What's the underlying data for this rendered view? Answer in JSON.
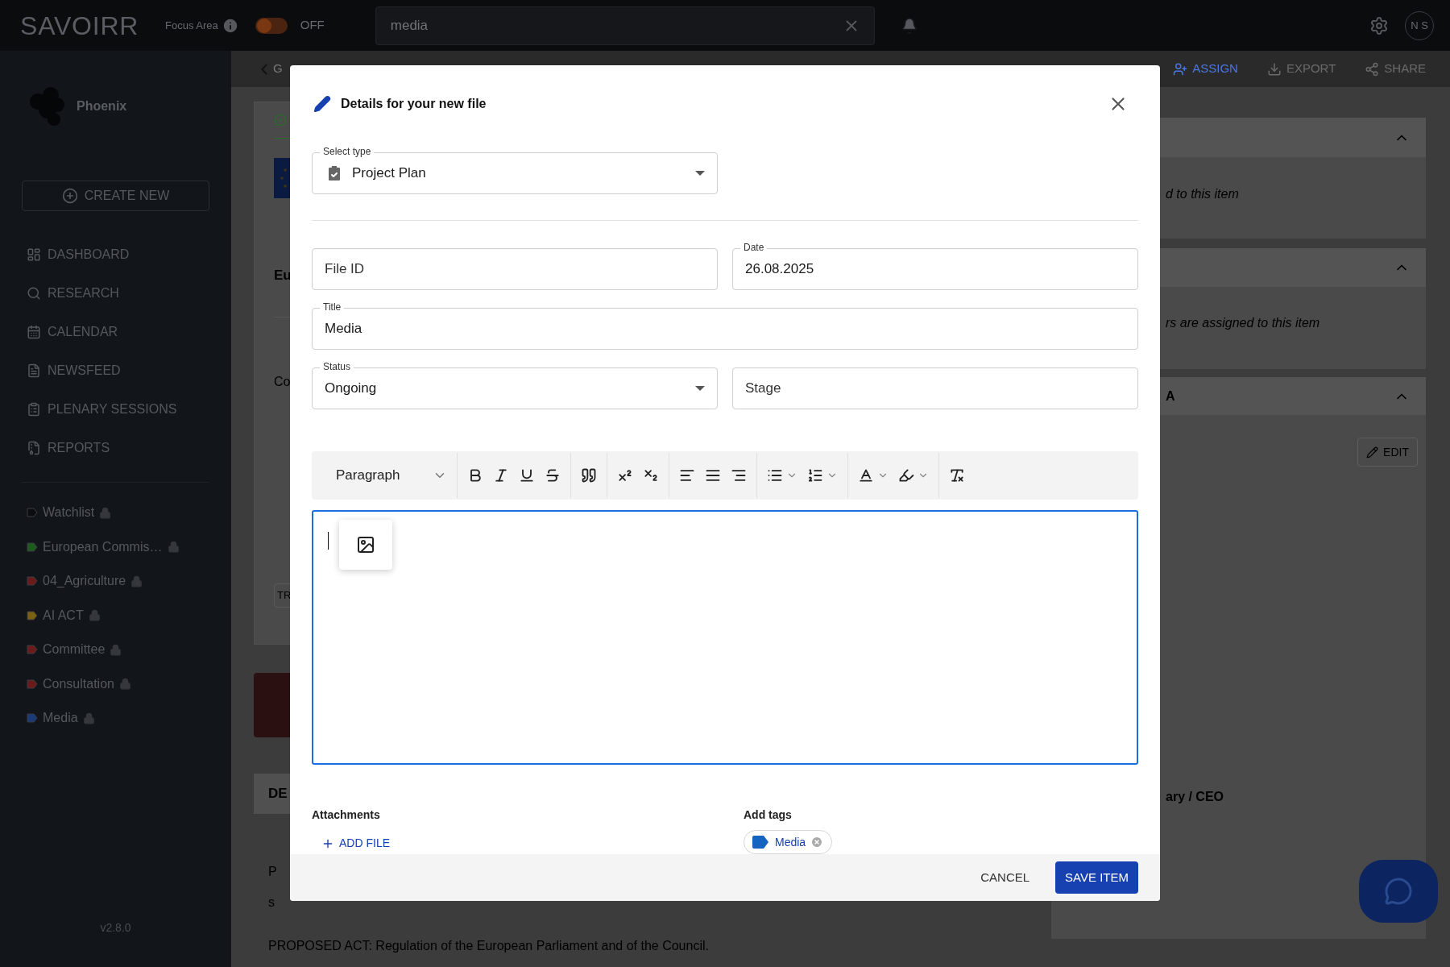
{
  "topbar": {
    "logo": "SAVOIRR",
    "focus_label": "Focus Area",
    "focus_toggle": {
      "on": false,
      "label": "OFF"
    },
    "search": {
      "value": "media"
    },
    "avatar": "N S"
  },
  "sidebar": {
    "workspace": "Phoenix",
    "create_button": "CREATE NEW",
    "nav": [
      "DASHBOARD",
      "RESEARCH",
      "CALENDAR",
      "NEWSFEED",
      "PLENARY SESSIONS",
      "REPORTS"
    ],
    "tags": [
      {
        "label": "Watchlist",
        "color": "#0b0d10",
        "locked": true
      },
      {
        "label": "European Commis…",
        "color": "#1f5a1f",
        "locked": true
      },
      {
        "label": "04_Agriculture",
        "color": "#6a1c1c",
        "locked": true
      },
      {
        "label": "AI ACT",
        "color": "#7a6212",
        "locked": true
      },
      {
        "label": "Committee",
        "color": "#6a1c1c",
        "locked": true
      },
      {
        "label": "Consultation",
        "color": "#6a1c1c",
        "locked": true
      },
      {
        "label": "Media",
        "color": "#1a3a7a",
        "locked": true
      }
    ],
    "version": "v2.8.0"
  },
  "page": {
    "back": "G",
    "actions": [
      {
        "label": "ASSIGN",
        "disabled": false
      },
      {
        "label": "EXPORT",
        "disabled": true
      },
      {
        "label": "SHARE",
        "disabled": true
      }
    ],
    "left_texts": [
      "Eu",
      "Co",
      "TR",
      "DE",
      "P",
      "s"
    ],
    "proposed_act": "PROPOSED ACT: Regulation of the European Parliament and of the Council.",
    "right_texts": [
      "d to this item",
      "rs are assigned to this item"
    ],
    "right_heading": "A",
    "edit_button": "EDIT",
    "role": "ary / CEO"
  },
  "dialog": {
    "title": "Details for your new file",
    "type_select": {
      "label": "Select type",
      "value": "Project Plan"
    },
    "file_id": {
      "placeholder": "File ID"
    },
    "date": {
      "label": "Date",
      "value": "26.08.2025"
    },
    "title_field": {
      "label": "Title",
      "value": "Media"
    },
    "status": {
      "label": "Status",
      "value": "Ongoing"
    },
    "stage": {
      "placeholder": "Stage"
    },
    "toolbar": {
      "block_style": "Paragraph"
    },
    "attachments": {
      "label": "Attachments",
      "add_button": "ADD FILE"
    },
    "tags": {
      "label": "Add tags",
      "items": [
        {
          "label": "Media",
          "color": "#1565c0"
        }
      ]
    },
    "buttons": {
      "cancel": "CANCEL",
      "save": "SAVE ITEM"
    }
  }
}
